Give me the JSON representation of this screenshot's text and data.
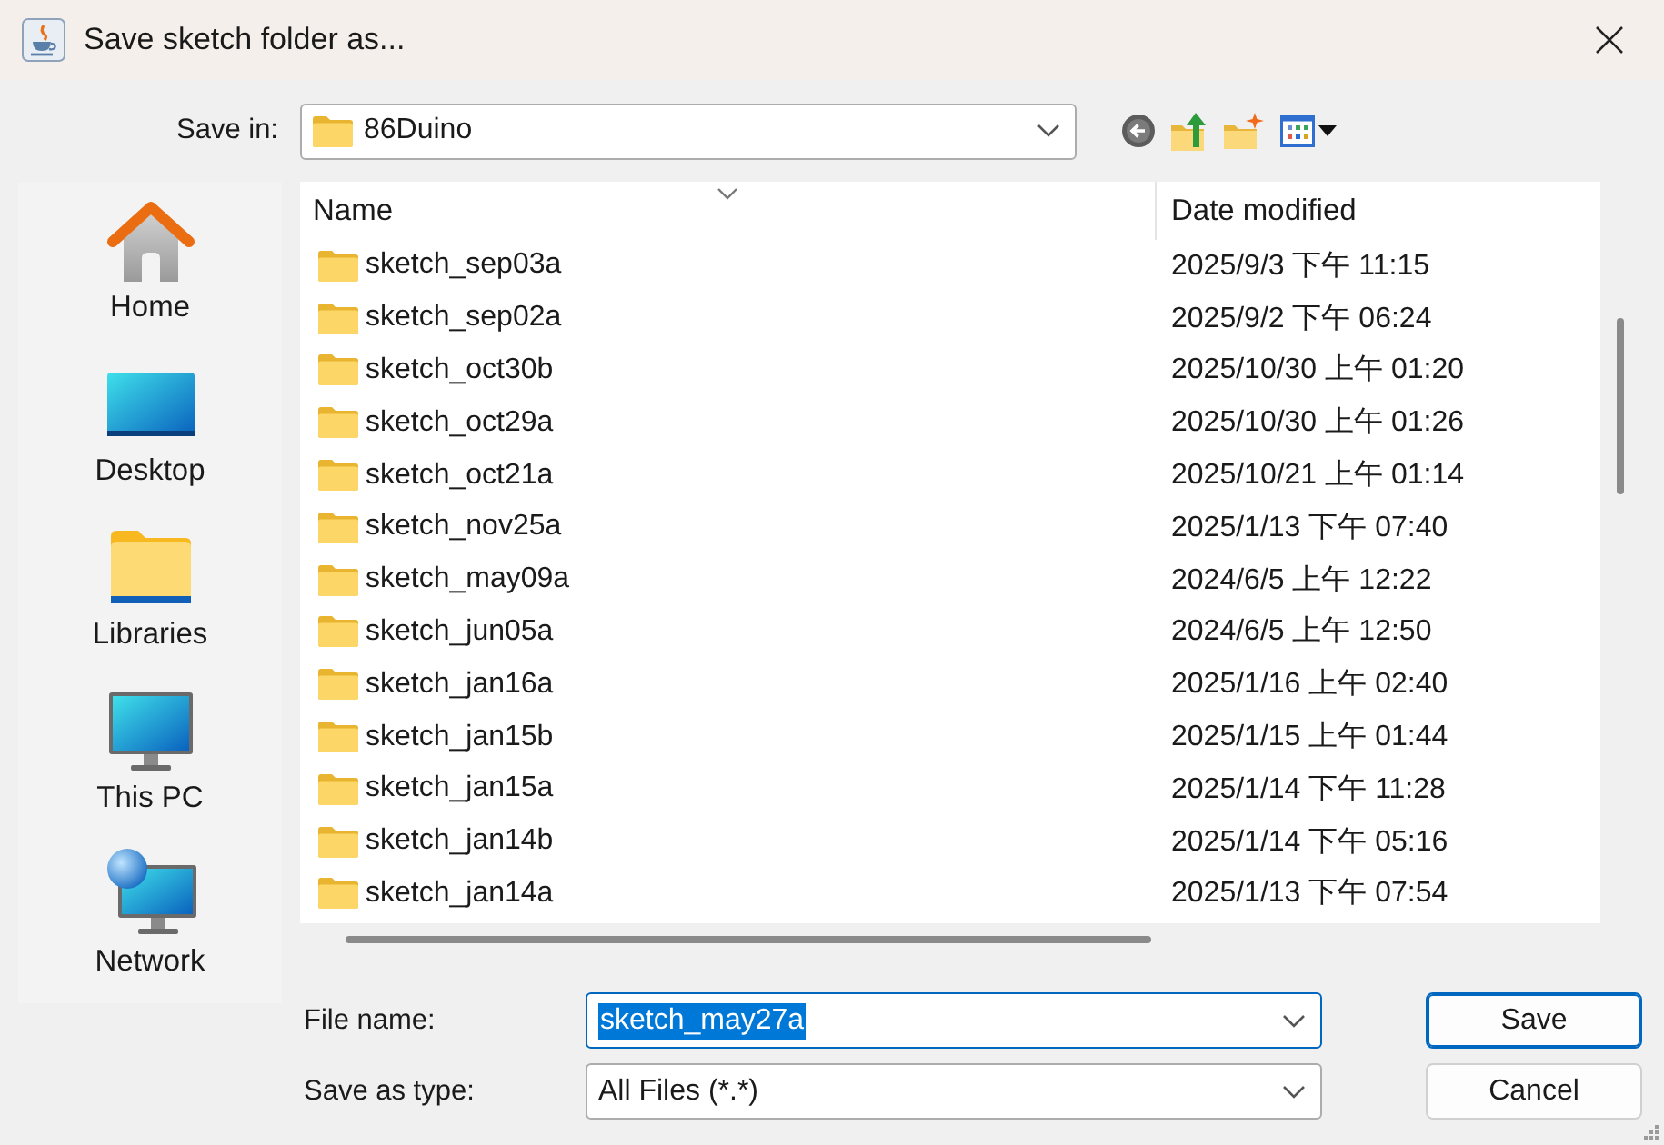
{
  "window": {
    "title": "Save sketch folder as..."
  },
  "save_in": {
    "label": "Save in:",
    "value": "86Duino"
  },
  "places": [
    {
      "kind": "home",
      "label": "Home",
      "selected": false
    },
    {
      "kind": "desktop",
      "label": "Desktop",
      "selected": false
    },
    {
      "kind": "libraries",
      "label": "Libraries",
      "selected": false
    },
    {
      "kind": "this_pc",
      "label": "This PC",
      "selected": false
    },
    {
      "kind": "network",
      "label": "Network",
      "selected": false
    }
  ],
  "file_list": {
    "columns": [
      {
        "label": "Name",
        "sorted": true
      },
      {
        "label": "Date modified",
        "sorted": false
      }
    ],
    "rows": [
      {
        "name": "sketch_sep03a",
        "date": "2025/9/3 下午 11:15",
        "selected": false
      },
      {
        "name": "sketch_sep02a",
        "date": "2025/9/2 下午 06:24",
        "selected": false
      },
      {
        "name": "sketch_oct30b",
        "date": "2025/10/30 上午 01:20",
        "selected": false
      },
      {
        "name": "sketch_oct29a",
        "date": "2025/10/30 上午 01:26",
        "selected": false
      },
      {
        "name": "sketch_oct21a",
        "date": "2025/10/21 上午 01:14",
        "selected": false
      },
      {
        "name": "sketch_nov25a",
        "date": "2025/1/13 下午 07:40",
        "selected": false
      },
      {
        "name": "sketch_may09a",
        "date": "2024/6/5 上午 12:22",
        "selected": false
      },
      {
        "name": "sketch_jun05a",
        "date": "2024/6/5 上午 12:50",
        "selected": false
      },
      {
        "name": "sketch_jan16a",
        "date": "2025/1/16 上午 02:40",
        "selected": false
      },
      {
        "name": "sketch_jan15b",
        "date": "2025/1/15 上午 01:44",
        "selected": false
      },
      {
        "name": "sketch_jan15a",
        "date": "2025/1/14 下午 11:28",
        "selected": false
      },
      {
        "name": "sketch_jan14b",
        "date": "2025/1/14 下午 05:16",
        "selected": false
      },
      {
        "name": "sketch_jan14a",
        "date": "2025/1/13 下午 07:54",
        "selected": false
      }
    ]
  },
  "file_name": {
    "label": "File name:",
    "value": "sketch_may27a",
    "focused": true
  },
  "save_as_type": {
    "label": "Save as type:",
    "value": "All Files (*.*)"
  },
  "buttons": [
    {
      "label": "Save",
      "default": true
    },
    {
      "label": "Cancel",
      "default": false
    }
  ]
}
